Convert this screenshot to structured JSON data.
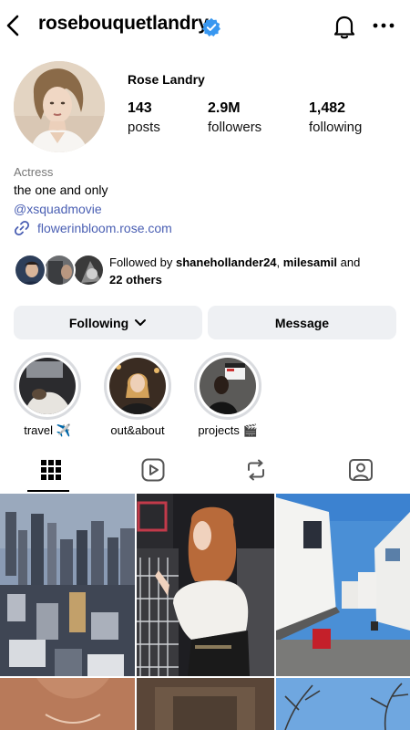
{
  "header": {
    "username": "rosebouquetlandry",
    "back_icon": "chevron-left-icon",
    "verified_icon": "verified-badge-icon",
    "notifications_icon": "bell-icon",
    "more_icon": "more-horizontal-icon"
  },
  "profile": {
    "display_name": "Rose Landry",
    "stats": [
      {
        "value": "143",
        "label": "posts"
      },
      {
        "value": "2.9M",
        "label": "followers"
      },
      {
        "value": "1,482",
        "label": "following"
      }
    ],
    "category": "Actress",
    "bio": "the one and only",
    "tag": "@xsquadmovie",
    "link": "flowerinbloom.rose.com"
  },
  "followed_by": {
    "prefix": "Followed by ",
    "user1": "shanehollander24",
    "sep": ", ",
    "user2": "milesamil",
    "and": " and",
    "others": "22 others"
  },
  "actions": {
    "following_label": "Following",
    "message_label": "Message"
  },
  "highlights": [
    {
      "label": "travel ✈️"
    },
    {
      "label": "out&about"
    },
    {
      "label": "projects 🎬"
    }
  ],
  "tabs": [
    "grid-icon",
    "reels-icon",
    "reposts-icon",
    "tagged-icon"
  ],
  "colors": {
    "accent_link": "#4a5fb3",
    "verified_blue": "#3897f0",
    "button_bg": "#eef0f3"
  }
}
